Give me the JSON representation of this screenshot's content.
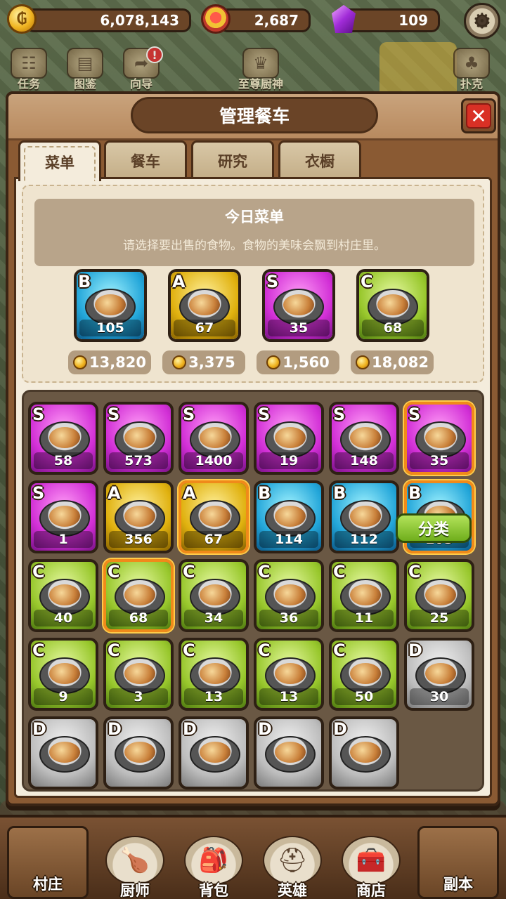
{
  "resources": {
    "gold": "6,078,143",
    "medals": "2,687",
    "gems": "109"
  },
  "quick_menu": [
    {
      "label": "任务",
      "icon": "quest-icon"
    },
    {
      "label": "图鉴",
      "icon": "book-icon"
    },
    {
      "label": "向导",
      "icon": "signpost-icon",
      "alert": "!"
    },
    {
      "label": "至尊厨神",
      "icon": "trophy-icon"
    },
    {
      "label": "扑克",
      "icon": "bird-icon"
    }
  ],
  "dialog": {
    "title": "管理餐车",
    "tabs": [
      "菜单",
      "餐车",
      "研究",
      "衣橱"
    ],
    "active_tab": "菜单"
  },
  "today_menu": {
    "title": "今日菜单",
    "description": "请选择要出售的食物。食物的美味会飘到村庄里。",
    "items": [
      {
        "rank": "B",
        "count": "105",
        "price": "13,820"
      },
      {
        "rank": "A",
        "count": "67",
        "price": "3,375"
      },
      {
        "rank": "S",
        "count": "35",
        "price": "1,560"
      },
      {
        "rank": "C",
        "count": "68",
        "price": "18,082"
      }
    ]
  },
  "recipes": [
    {
      "rank": "S",
      "count": "58",
      "selected": false
    },
    {
      "rank": "S",
      "count": "573",
      "selected": false
    },
    {
      "rank": "S",
      "count": "1400",
      "selected": false
    },
    {
      "rank": "S",
      "count": "19",
      "selected": false
    },
    {
      "rank": "S",
      "count": "148",
      "selected": false
    },
    {
      "rank": "S",
      "count": "35",
      "selected": true
    },
    {
      "rank": "S",
      "count": "1",
      "selected": false
    },
    {
      "rank": "A",
      "count": "356",
      "selected": false
    },
    {
      "rank": "A",
      "count": "67",
      "selected": true
    },
    {
      "rank": "B",
      "count": "114",
      "selected": false
    },
    {
      "rank": "B",
      "count": "112",
      "selected": false
    },
    {
      "rank": "B",
      "count": "105",
      "selected": true
    },
    {
      "rank": "C",
      "count": "40",
      "selected": false
    },
    {
      "rank": "C",
      "count": "68",
      "selected": true
    },
    {
      "rank": "C",
      "count": "34",
      "selected": false
    },
    {
      "rank": "C",
      "count": "36",
      "selected": false
    },
    {
      "rank": "C",
      "count": "11",
      "selected": false
    },
    {
      "rank": "C",
      "count": "25",
      "selected": false
    },
    {
      "rank": "C",
      "count": "9",
      "selected": false
    },
    {
      "rank": "C",
      "count": "3",
      "selected": false
    },
    {
      "rank": "C",
      "count": "13",
      "selected": false
    },
    {
      "rank": "C",
      "count": "13",
      "selected": false
    },
    {
      "rank": "C",
      "count": "50",
      "selected": false
    },
    {
      "rank": "D",
      "count": "30",
      "selected": false
    },
    {
      "rank": "D",
      "count": "",
      "selected": false
    },
    {
      "rank": "D",
      "count": "",
      "selected": false
    },
    {
      "rank": "D",
      "count": "",
      "selected": false
    },
    {
      "rank": "D",
      "count": "",
      "selected": false
    },
    {
      "rank": "D",
      "count": "",
      "selected": false
    }
  ],
  "sort_button": "分类",
  "bottom_nav": [
    {
      "label": "村庄",
      "icon": "village-icon"
    },
    {
      "label": "厨师",
      "icon": "chef-icon"
    },
    {
      "label": "背包",
      "icon": "backpack-icon"
    },
    {
      "label": "英雄",
      "icon": "helmet-icon"
    },
    {
      "label": "商店",
      "icon": "chest-icon"
    },
    {
      "label": "副本",
      "icon": "map-icon"
    }
  ]
}
